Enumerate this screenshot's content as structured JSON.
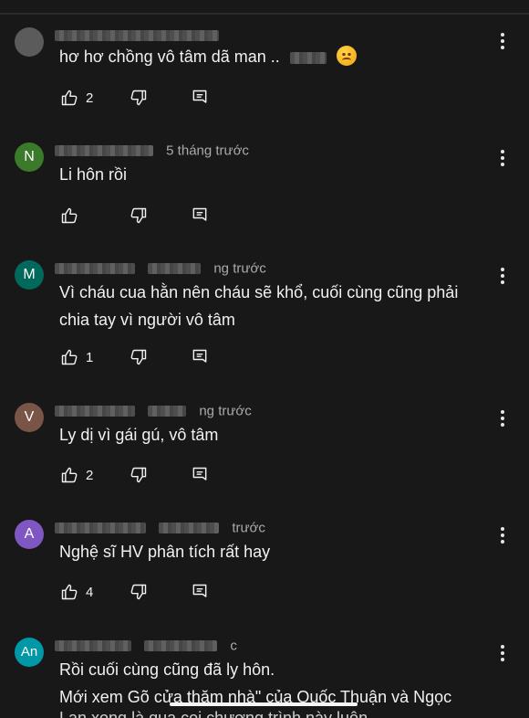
{
  "comments": [
    {
      "avatar_letter": "",
      "avatar_color": "#5b5b5b",
      "time": "",
      "text": "hơ hơ chồng vô tâm dã man ..",
      "likes": "2",
      "emoji": "angry-face"
    },
    {
      "avatar_letter": "N",
      "avatar_color": "#3b7a2a",
      "time": "5 tháng trước",
      "text": "Li hôn rồi",
      "likes": ""
    },
    {
      "avatar_letter": "M",
      "avatar_color": "#00695c",
      "time": "ng trước",
      "text": "Vì cháu cua hằn nên cháu sẽ khổ, cuối cùng cũng phải chia tay vì người vô tâm",
      "likes": "1"
    },
    {
      "avatar_letter": "V",
      "avatar_color": "#795548",
      "time": "ng trước",
      "text": "Ly dị vì gái gú, vô tâm",
      "likes": "2"
    },
    {
      "avatar_letter": "A",
      "avatar_color": "#7e57c2",
      "time": "trước",
      "text": "Nghệ sĩ HV phân tích rất hay",
      "likes": "4"
    },
    {
      "avatar_letter": "An",
      "avatar_color": "#0097a7",
      "time": "c",
      "text_line1": "Rồi cuối cùng cũng đã ly hôn.",
      "text_line2": "Mới xem Gõ cửa thăm nhà\" của Quốc Thuận và Ngọc",
      "text_line3": "Lan xong là qua coi chương trình này luôn"
    }
  ],
  "icons": {
    "like": "thumb-up-icon",
    "dislike": "thumb-down-icon",
    "reply": "reply-icon",
    "more": "more-vert-icon"
  }
}
